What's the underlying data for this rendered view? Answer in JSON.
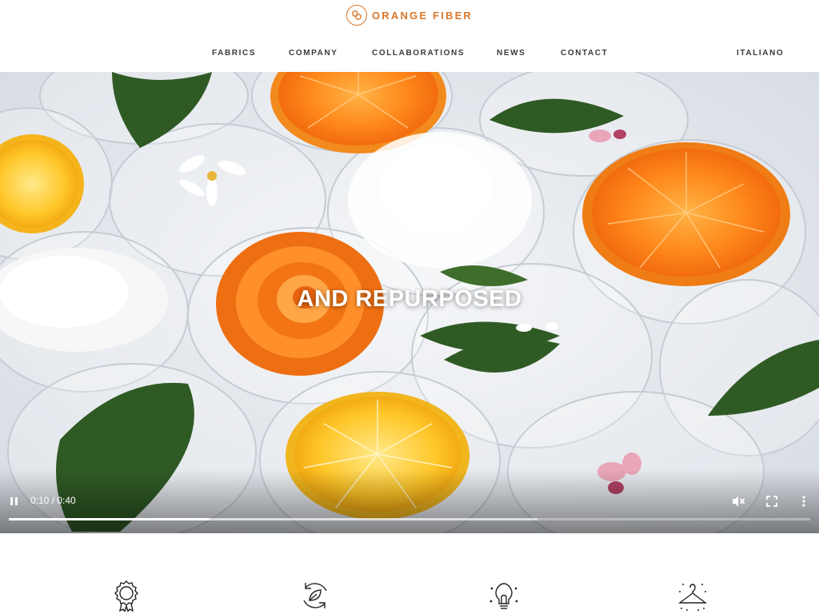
{
  "brand": {
    "name": "ORANGE FIBER",
    "logo_icon": "orange-fiber-logo-icon",
    "accent_color": "#d9772b"
  },
  "nav": {
    "items": [
      {
        "label": "FABRICS"
      },
      {
        "label": "COMPANY"
      },
      {
        "label": "COLLABORATIONS"
      },
      {
        "label": "NEWS"
      },
      {
        "label": "CONTACT"
      }
    ],
    "language": "ITALIANO"
  },
  "hero": {
    "overlay_text": "AND REPURPOSED",
    "player": {
      "time_display": "0:10 / 0:40",
      "current_seconds": 10,
      "duration_seconds": 40,
      "buffered_fraction": 0.66,
      "muted": true,
      "icons": {
        "pause": "pause-icon",
        "mute": "volume-muted-icon",
        "fullscreen": "fullscreen-icon",
        "more": "more-vertical-icon"
      }
    }
  },
  "features": {
    "icons": [
      "award-badge-icon",
      "recycle-leaf-icon",
      "lightbulb-icon",
      "hanger-icon"
    ]
  }
}
